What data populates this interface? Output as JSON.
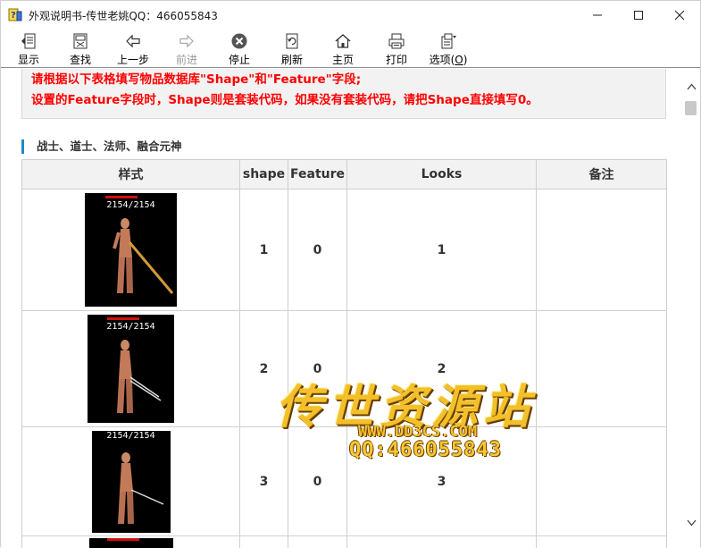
{
  "window": {
    "title": "外观说明书-传世老姚QQ：466055843",
    "controls": {
      "minimize": "minimize",
      "maximize": "maximize",
      "close": "close"
    }
  },
  "toolbar": {
    "items": [
      {
        "label": "显示",
        "icon": "show-icon",
        "enabled": true
      },
      {
        "label": "查找",
        "icon": "find-icon",
        "enabled": true
      },
      {
        "label": "上一步",
        "icon": "back-arrow-icon",
        "enabled": true
      },
      {
        "label": "前进",
        "icon": "forward-arrow-icon",
        "enabled": false
      },
      {
        "label": "停止",
        "icon": "stop-icon",
        "enabled": true
      },
      {
        "label": "刷新",
        "icon": "refresh-icon",
        "enabled": true
      },
      {
        "label": "主页",
        "icon": "home-icon",
        "enabled": true
      },
      {
        "label": "打印",
        "icon": "print-icon",
        "enabled": true
      },
      {
        "label": "选项(",
        "label_key": "O",
        "label_end": ")",
        "icon": "options-icon",
        "enabled": true
      }
    ]
  },
  "notice": {
    "line1": "请根据以下表格填写物品数据库\"Shape\"和\"Feature\"字段;",
    "line2": "设置的Feature字段时，Shape则是套装代码，如果没有套装代码，请把Shape直接填写0。"
  },
  "section": {
    "title": "战士、道士、法师、融合元神"
  },
  "table": {
    "headers": [
      "样式",
      "shape",
      "Feature",
      "Looks",
      "备注"
    ],
    "rows": [
      {
        "hp": "2154/2154",
        "shape": "1",
        "feature": "0",
        "looks": "1",
        "note": ""
      },
      {
        "hp": "2154/2154",
        "shape": "2",
        "feature": "0",
        "looks": "2",
        "note": ""
      },
      {
        "hp": "2154/2154",
        "shape": "3",
        "feature": "0",
        "looks": "3",
        "note": ""
      }
    ]
  },
  "watermark": {
    "title": "传世资源站",
    "url": "WWW.DD3CS.COM",
    "qq": "QQ:466055843"
  },
  "colors": {
    "notice_text": "#ff0000",
    "section_accent": "#1e88c8",
    "watermark_gold": "#f3c02a"
  }
}
